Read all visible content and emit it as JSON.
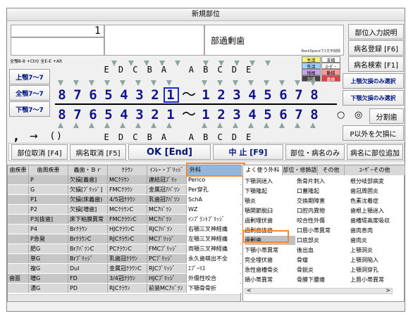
{
  "window": {
    "title": "新規部位"
  },
  "inputs": {
    "number_value": "1",
    "part_name": "部過剰歯",
    "backspace_hint": "BackSpaceで1文字削除"
  },
  "right_buttons": [
    "部位入力説明",
    "病名登録 [F6]",
    "病名検索 [F1]",
    "上顎欠損のみ選択",
    "下顎欠損のみ選択",
    "分割歯",
    "P以外を欠損に"
  ],
  "radio": {
    "a": "○",
    "b": "◎"
  },
  "legend": [
    [
      "生活",
      "支橋"
    ],
    [
      "失活",
      "ﾛｰﾀﾞｰ"
    ],
    [
      "残根",
      "動揺"
    ],
    [
      "欠損",
      "義歯"
    ]
  ],
  "chart": {
    "shortcut_hint": "全顎8-8 +Ctrl/ 全E-E +Alt",
    "upper_label": "上顎7～7",
    "all_label": "全顎7～7",
    "lower_label": "下顎7～7",
    "tilde": "～",
    "deciduous_upper": [
      "E",
      "D",
      "C",
      "B",
      "A",
      "A",
      "B",
      "C",
      "D",
      "E"
    ],
    "deciduous_lower": [
      "E",
      "D",
      "C",
      "B",
      "A",
      "A",
      "B",
      "C",
      "D",
      "E"
    ],
    "upper_teeth": [
      "8",
      "7",
      "6",
      "5",
      "4",
      "3",
      "2",
      "1",
      "1",
      "2",
      "3",
      "4",
      "5",
      "6",
      "7",
      "8"
    ],
    "lower_teeth": [
      "8",
      "7",
      "6",
      "5",
      "4",
      "3",
      "2",
      "1",
      "1",
      "2",
      "3",
      "4",
      "5",
      "6",
      "7",
      "8"
    ],
    "selected_tooth": "upper-right-1",
    "arrows": {
      "comma": ",",
      "arrow": "→",
      "paren": "( )"
    }
  },
  "action_bar": {
    "cancel_part": "部位取消 [F4]",
    "cancel_name": "病名取消 [F5]",
    "ok": "OK [End]",
    "abort": "中 止 [F9]",
    "part_name_order": "部位・病名のみ",
    "add_part": "病名に部位追加"
  },
  "grid": {
    "headers": [
      "歯疾患",
      "歯周疾患",
      "義歯・Ｂｒ",
      "ｸﾗｳﾝ",
      "ｲﾝﾚｰ・ﾌﾞﾘｯｼﾞ"
    ],
    "rows": [
      [
        "",
        "P",
        "欠損[義歯]",
        "MCｸﾗｳﾝ",
        "連結冠ﾌﾞﾘｯ"
      ],
      [
        "",
        "G",
        "欠損[ﾌﾞﾘｯｼﾞ]",
        "FMCｸﾗｳﾝ",
        "金属冠ｱﾊﾞﾂﾝ"
      ],
      [
        "",
        "P1",
        "欠損(床義歯)",
        "4/5冠ｸﾗｳﾝ",
        "乳歯冠ｱﾊﾞﾂﾝ"
      ],
      [
        "",
        "P2",
        "欠損[増歯]",
        "MCｸﾗｳﾝC",
        "MCｱﾊﾞﾂﾝ"
      ],
      [
        "",
        "P3[抜歯]",
        "床下粘膜異常",
        "FMCｸﾗｳﾝC",
        "MCｱﾊﾞﾂﾝ"
      ],
      [
        "",
        "P4",
        "Brｸﾗｳﾝ",
        "HJCｸﾗｳﾝC",
        "RJCｱﾊﾞﾂﾝ"
      ],
      [
        "",
        "P急発",
        "BrｸﾗｳﾝC",
        "RJCｸﾗｳﾝC",
        "MCﾌﾞﾘｯｼﾞ"
      ],
      [
        "",
        "肥G",
        "BrｱﾊﾞﾂﾝC",
        "PCｸﾗｳﾝC",
        "FMCﾌﾞﾘｯｼﾞ"
      ],
      [
        "",
        "単G",
        "Brﾌﾞﾘｯｼﾞ",
        "乳歯冠ｸﾗｳﾝ",
        "PCﾌﾞﾘｯｼﾞ"
      ],
      [
        "",
        "複G",
        "Dul",
        "金属冠ｸﾗｳﾝC",
        "RJCﾌﾞﾘｯｼﾞ"
      ],
      [
        "歯面",
        "増G",
        "FD",
        "3/4冠ｸﾗｳﾝ",
        "HJCﾌﾞﾘｯｼﾞ"
      ],
      [
        "",
        "濃G",
        "PD",
        "RJCｸﾗｳﾝ",
        "前装MCｱﾊﾞﾂﾝ"
      ]
    ]
  },
  "geka": {
    "tab": "外科",
    "items": [
      "Perico",
      "Per穿孔",
      "SchA",
      "WZ",
      "ｲﾝﾌﾟﾗﾝﾄﾌﾞﾘｯｼﾞ",
      "右顎三叉神経痛",
      "左顎三叉神経痛",
      "両顎三叉神経痛",
      "永久歯萌出不全",
      "ｴﾌﾟｰﾘｽ",
      "外傷性咬合",
      "下顎骨骨折"
    ]
  },
  "tabs": {
    "frequent": "よく使う外科",
    "part_mod": "部位・修飾語",
    "other": "その他",
    "user": "ﾕｰｻﾞｰその他"
  },
  "frequent": {
    "col1": [
      "下顎洞迷入",
      "下顎隆起",
      "顎炎",
      "顎関節脱臼",
      "過剰埋伏歯",
      "過剰歯抜歯",
      "過剰歯",
      "下顎小帯異常",
      "完全埋伏歯",
      "急性歯槽骨炎",
      "頬小帯異常"
    ],
    "col2": [
      "魚骨片刺入",
      "口蓋隆起",
      "交換期障害",
      "口腔内異物",
      "咬合性外傷",
      "口唇小帯異常",
      "口底部炎",
      "後出血",
      "骨瘤",
      "骨鋭炎",
      "骨膜下膿瘍"
    ],
    "col3": [
      "根分岐部病変",
      "歯冠周囲炎",
      "色素沈着症",
      "歯根上顎迷入",
      "歯槽堤高度吸収",
      "歯肉息肉",
      "歯肉炎",
      "上顎洞炎",
      "上顎洞陥入",
      "上顎洞穿孔",
      "上唇小帯異常"
    ],
    "selected": "過剰歯"
  }
}
